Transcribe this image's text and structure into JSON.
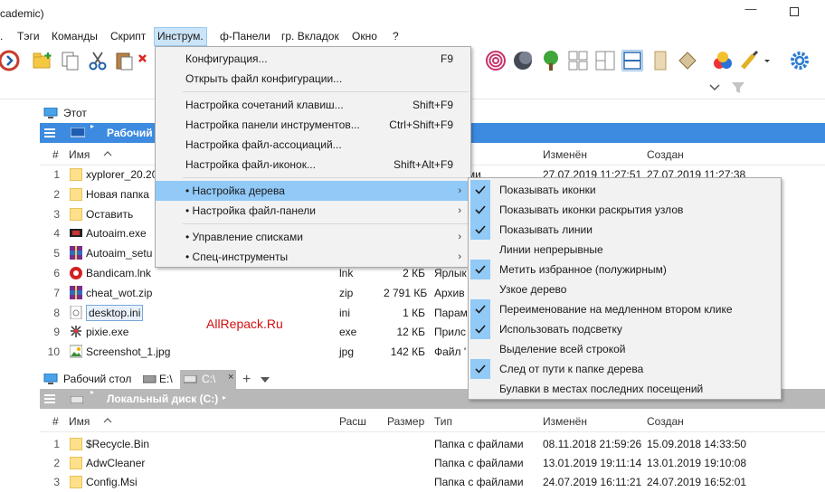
{
  "window": {
    "title": "cademic)",
    "minimize_label": "—"
  },
  "menubar": {
    "items": [
      {
        "label": "Тэги",
        "x": 0
      },
      {
        "label": "Команды",
        "x": 0
      },
      {
        "label": "Скрипт",
        "x": 0
      },
      {
        "label": "Инструм.",
        "x": 0
      },
      {
        "label": "ф-Панели",
        "x": 0
      },
      {
        "label": "гр. Вкладок",
        "x": 0
      },
      {
        "label": "Окно",
        "x": 0
      },
      {
        "label": "?",
        "x": 0
      }
    ],
    "prefix": "."
  },
  "top_pane": {
    "tab": "Этот компьютер",
    "path": "Рабочий",
    "header": {
      "num": "#",
      "name": "Имя",
      "modified": "Изменён",
      "created": "Создан"
    },
    "rows": [
      {
        "num": "1",
        "name": "xyplorer_20.20",
        "ext": "",
        "size": "",
        "type": "файлами",
        "modified": "27.07.2019 11:27:51",
        "created": "27.07.2019 11:27:38",
        "icon": "folder"
      },
      {
        "num": "2",
        "name": "Новая папка",
        "ext": "",
        "size": "",
        "type": "",
        "modified": "",
        "created": "",
        "icon": "folder"
      },
      {
        "num": "3",
        "name": "Оставить",
        "ext": "",
        "size": "",
        "type": "",
        "modified": "",
        "created": "",
        "icon": "folder"
      },
      {
        "num": "4",
        "name": "Autoaim.exe",
        "ext": "",
        "size": "",
        "type": "",
        "modified": "",
        "created": "",
        "icon": "exe"
      },
      {
        "num": "5",
        "name": "Autoaim_setu",
        "ext": "",
        "size": "",
        "type": "",
        "modified": "",
        "created": "",
        "icon": "archive"
      },
      {
        "num": "6",
        "name": "Bandicam.lnk",
        "ext": "lnk",
        "size": "2 КБ",
        "type": "Ярлык",
        "modified": "",
        "created": "",
        "icon": "bandicam"
      },
      {
        "num": "7",
        "name": "cheat_wot.zip",
        "ext": "zip",
        "size": "2 791 КБ",
        "type": "Архив",
        "modified": "",
        "created": "",
        "icon": "archive"
      },
      {
        "num": "8",
        "name": "desktop.ini",
        "ext": "ini",
        "size": "1 КБ",
        "type": "Парам",
        "modified": "",
        "created": "",
        "icon": "ini"
      },
      {
        "num": "9",
        "name": "pixie.exe",
        "ext": "exe",
        "size": "12 КБ",
        "type": "Прилс",
        "modified": "",
        "created": "",
        "icon": "pixie"
      },
      {
        "num": "10",
        "name": "Screenshot_1.jpg",
        "ext": "jpg",
        "size": "142 КБ",
        "type": "Файл '",
        "modified": "",
        "created": "",
        "icon": "image"
      }
    ]
  },
  "bottom_pane": {
    "tabs": [
      "Рабочий стол",
      "E:\\",
      "C:\\"
    ],
    "tab_close": "×",
    "tab_add": "+",
    "path": "Локальный диск (C:)",
    "header": {
      "num": "#",
      "name": "Имя",
      "ext": "Расш",
      "size": "Размер",
      "type": "Тип",
      "modified": "Изменён",
      "created": "Создан"
    },
    "rows": [
      {
        "num": "1",
        "name": "$Recycle.Bin",
        "type": "Папка с файлами",
        "modified": "08.11.2018 21:59:26",
        "created": "15.09.2018 14:33:50"
      },
      {
        "num": "2",
        "name": "AdwCleaner",
        "type": "Папка с файлами",
        "modified": "13.01.2019 19:11:14",
        "created": "13.01.2019 19:10:08"
      },
      {
        "num": "3",
        "name": "Config.Msi",
        "type": "Папка с файлами",
        "modified": "24.07.2019 16:11:21",
        "created": "24.07.2019 16:52:01"
      }
    ]
  },
  "watermark": "AllRepack.Ru",
  "dropdown": {
    "items": [
      {
        "label": "Конфигурация...",
        "shortcut": "F9"
      },
      {
        "label": "Открыть файл конфигурации...",
        "shortcut": ""
      },
      {
        "label": "Настройка сочетаний клавиш...",
        "shortcut": "Shift+F9"
      },
      {
        "label": "Настройка панели инструментов...",
        "shortcut": "Ctrl+Shift+F9"
      },
      {
        "label": "Настройка файл-ассоциаций...",
        "shortcut": ""
      },
      {
        "label": "Настройка файл-иконок...",
        "shortcut": "Shift+Alt+F9"
      },
      {
        "label": "• Настройка дерева",
        "shortcut": ""
      },
      {
        "label": "• Настройка файл-панели",
        "shortcut": ""
      },
      {
        "label": "• Управление списками",
        "shortcut": ""
      },
      {
        "label": "• Спец-инструменты",
        "shortcut": ""
      }
    ],
    "arrow": "›"
  },
  "submenu": {
    "items": [
      {
        "label": "Показывать иконки",
        "checked": true
      },
      {
        "label": "Показывать иконки раскрытия узлов",
        "checked": true
      },
      {
        "label": "Показывать линии",
        "checked": true
      },
      {
        "label": "Линии непрерывные",
        "checked": false
      },
      {
        "label": "Метить избранное (полужирным)",
        "checked": true
      },
      {
        "label": "Узкое дерево",
        "checked": false
      },
      {
        "label": "Переименование на медленном втором клике",
        "checked": true
      },
      {
        "label": "Использовать подсветку",
        "checked": true
      },
      {
        "label": "Выделение всей строкой",
        "checked": false
      },
      {
        "label": "След от пути к папке дерева",
        "checked": true
      },
      {
        "label": "Булавки в местах последних посещений",
        "checked": false
      }
    ]
  },
  "colors": {
    "accent": "#3c8be0",
    "menu_highlight": "#91c9f7",
    "grey_path": "#b8b8b8",
    "watermark": "#d01010"
  }
}
